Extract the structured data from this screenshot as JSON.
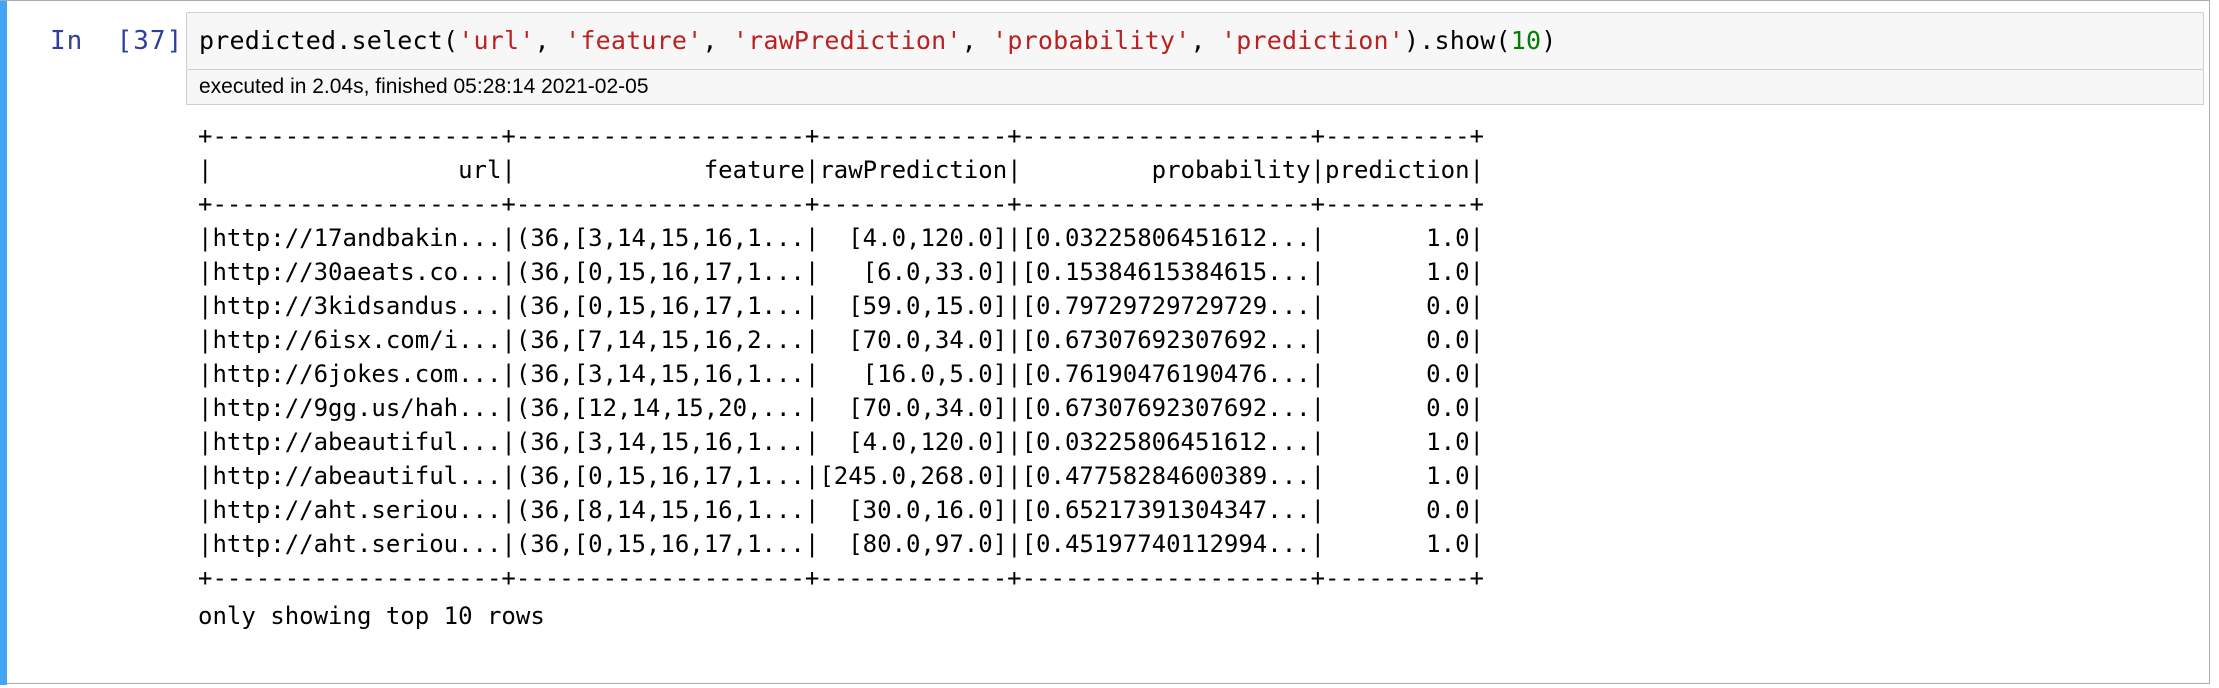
{
  "cell": {
    "prompt_label": "In  [37]:",
    "code": {
      "prefix": "predicted.select(",
      "args": [
        "'url'",
        "'feature'",
        "'rawPrediction'",
        "'probability'",
        "'prediction'"
      ],
      "separator": ", ",
      "middle": ").show(",
      "number": "10",
      "suffix": ")"
    },
    "execution_info": "executed in 2.04s, finished 05:28:14 2021-02-05"
  },
  "output": {
    "lines": [
      "+--------------------+--------------------+-------------+--------------------+----------+",
      "|                 url|             feature|rawPrediction|         probability|prediction|",
      "+--------------------+--------------------+-------------+--------------------+----------+",
      "|http://17andbakin...|(36,[3,14,15,16,1...|  [4.0,120.0]|[0.03225806451612...|       1.0|",
      "|http://30aeats.co...|(36,[0,15,16,17,1...|   [6.0,33.0]|[0.15384615384615...|       1.0|",
      "|http://3kidsandus...|(36,[0,15,16,17,1...|  [59.0,15.0]|[0.79729729729729...|       0.0|",
      "|http://6isx.com/i...|(36,[7,14,15,16,2...|  [70.0,34.0]|[0.67307692307692...|       0.0|",
      "|http://6jokes.com...|(36,[3,14,15,16,1...|   [16.0,5.0]|[0.76190476190476...|       0.0|",
      "|http://9gg.us/hah...|(36,[12,14,15,20,...|  [70.0,34.0]|[0.67307692307692...|       0.0|",
      "|http://abeautiful...|(36,[3,14,15,16,1...|  [4.0,120.0]|[0.03225806451612...|       1.0|",
      "|http://abeautiful...|(36,[0,15,16,17,1...|[245.0,268.0]|[0.47758284600389...|       1.0|",
      "|http://aht.seriou...|(36,[8,14,15,16,1...|  [30.0,16.0]|[0.65217391304347...|       0.0|",
      "|http://aht.seriou...|(36,[0,15,16,17,1...|  [80.0,97.0]|[0.45197740112994...|       1.0|",
      "+--------------------+--------------------+-------------+--------------------+----------+",
      "only showing top 10 rows"
    ]
  },
  "colors": {
    "accent": "#42a5f5",
    "prompt": "#303f9f",
    "string": "#ba2121",
    "number": "#008000"
  }
}
